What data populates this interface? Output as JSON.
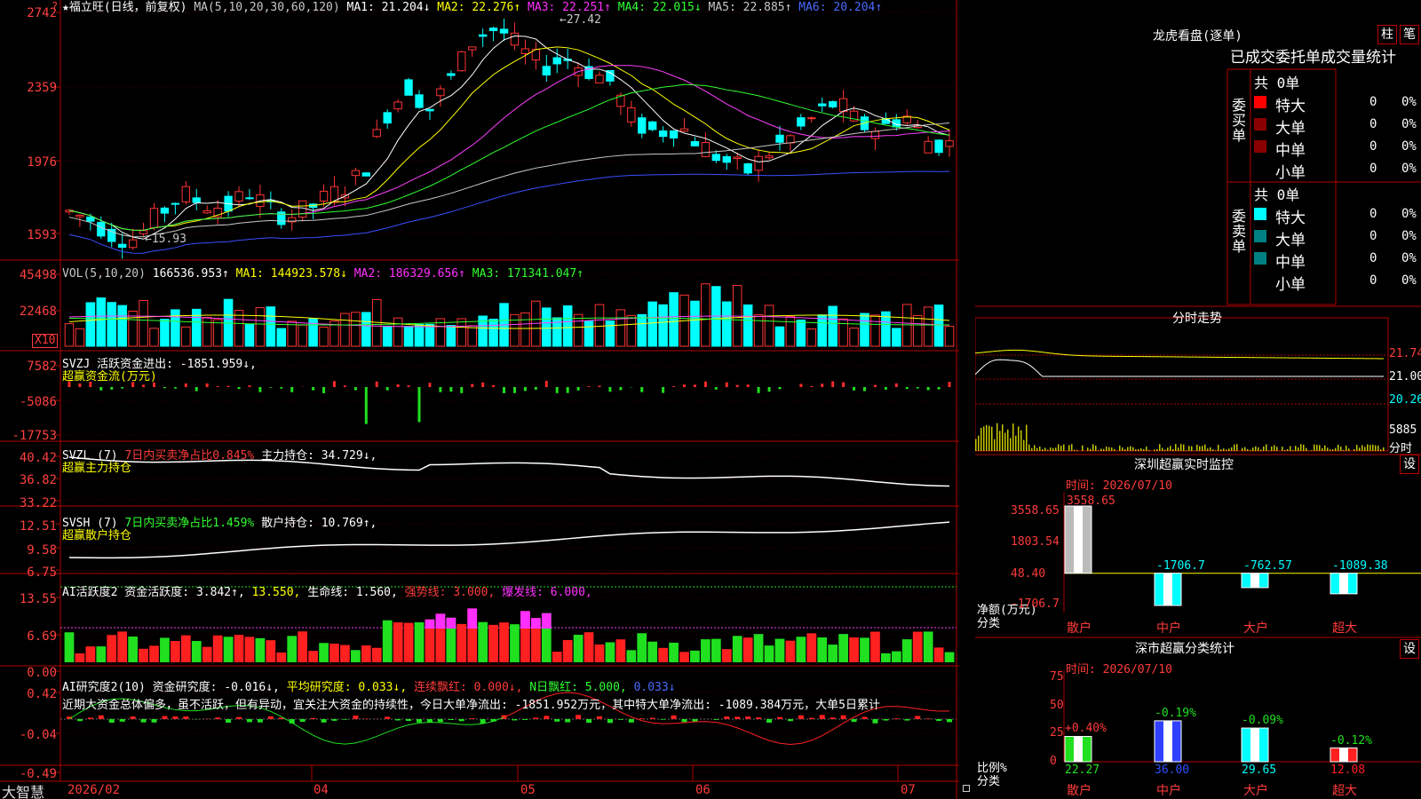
{
  "colors": {
    "up": "#ff3333",
    "down": "#00ffff",
    "bg": "#000000",
    "grid": "#b00000",
    "ma1": "#ffffff",
    "ma2": "#ffff00",
    "ma3": "#ff40ff",
    "ma4": "#30ff30",
    "ma5": "#c8c8c8",
    "ma6": "#3a50ff"
  },
  "main": {
    "title": "★福立旺(日线，前复权)",
    "ma_params": "MA(5,10,20,30,60,120)",
    "ma1": "MA1: 21.204↓",
    "ma2": "MA2: 22.276↑",
    "ma3": "MA3: 22.251↑",
    "ma4": "MA4: 22.015↓",
    "ma5": "MA5: 22.885↑",
    "ma6": "MA6: 20.204↑",
    "ticks": [
      "2742",
      "2359",
      "1976",
      "1593"
    ],
    "high_mark": "27.42",
    "low_mark": "15.93"
  },
  "vol": {
    "label": "VOL(5,10,20)",
    "value": "166536.953↑",
    "ma1": "MA1: 144923.578↓",
    "ma2": "MA2: 186329.656↑",
    "ma3": "MA3: 171341.047↑",
    "ticks": [
      "45498",
      "22468"
    ],
    "unit": "X10"
  },
  "svzj": {
    "label": "SVZJ  活跃资金进出: -1851.959↓,",
    "sub": "超赢资金流(万元)",
    "ticks": [
      "7582",
      "-5086",
      "-17753"
    ]
  },
  "svzl": {
    "label": "SVZL (7)",
    "pct": "7日内买卖净占比0.845%",
    "hold": "主力持仓: 34.729↓,",
    "sub": "超赢主力持仓",
    "ticks": [
      "40.42",
      "36.82",
      "33.22"
    ]
  },
  "svsh": {
    "label": "SVSH (7)",
    "pct": "7日内买卖净占比1.459%",
    "hold": "散户持仓: 10.769↑,",
    "sub": "超赢散户持仓",
    "ticks": [
      "12.51",
      "9.58",
      "6.75"
    ]
  },
  "ai1": {
    "label": "AI活跃度2 资金活跃度: 3.842↑,",
    "v2": "13.550,",
    "life": "生命线: 1.560,",
    "strong": "强势线: 3.000,",
    "burst": "爆发线: 6.000,",
    "ticks": [
      "13.55",
      "6.69",
      "0.00"
    ]
  },
  "ai2": {
    "label": "AI研究度2(10) 资金研究度: -0.016↓,",
    "avg": "平均研究度: 0.033↓,",
    "red": "连续飘红: 0.000↓,",
    "nday": "N日飘红: 5.000,",
    "last": "0.033↓",
    "desc": "近期大资金总体偏多，虽不活跃，但有异动，宜关注大资金的持续性，今日大单净流出: -1851.952万元，其中特大单净流出: -1089.384万元，大单5日累计",
    "ticks": [
      "0.42",
      "-0.04",
      "-0.49"
    ]
  },
  "xaxis": {
    "labels": [
      "2026/02",
      "04",
      "05",
      "06",
      "07"
    ],
    "brand": "大智慧"
  },
  "right": {
    "lhb_title": "龙虎看盘(逐单)",
    "btn1": "柱",
    "btn2": "笔",
    "stat_header": "已成交委托单成交量统计",
    "buy_label": "委买单",
    "sell_label": "委卖单",
    "total": "共 0单",
    "rows": [
      "特大",
      "大单",
      "中单",
      "小单"
    ],
    "zero": "0",
    "pct": "0%",
    "buy_colors": [
      "#ff0000",
      "#8a0000",
      "#8a0000",
      "#000000"
    ],
    "sell_colors": [
      "#00ffff",
      "#008080",
      "#008080",
      "#000000"
    ],
    "fs_title": "分时走势",
    "fs_ticks": [
      "21.74",
      "21.00",
      "20.26"
    ],
    "fs_vol": "5885",
    "fs_vol_unit": "分时",
    "mon_title": "深圳超赢实时监控",
    "mon_btn": "设",
    "mon_time": "时间: 2026/07/10",
    "mon_ticks": [
      "3558.65",
      "1803.54",
      "48.40",
      "-1706.7"
    ],
    "mon_unit": "净额(万元)",
    "mon_unit2": "分类",
    "mon_cats": [
      "散户",
      "中户",
      "大户",
      "超大"
    ],
    "mon_values": [
      3558.65,
      -1706.7,
      -762.57,
      -1089.38
    ],
    "mon_value_labels": [
      "3558.65",
      "-1706.7",
      "-762.57",
      "-1089.38"
    ],
    "cls_title": "深市超赢分类统计",
    "cls_btn": "设",
    "cls_time": "时间: 2026/07/10",
    "cls_ticks": [
      "75",
      "50",
      "25",
      "0"
    ],
    "cls_unit": "比例%",
    "cls_unit2": "分类",
    "cls_values": [
      22.27,
      36.0,
      29.65,
      12.08
    ],
    "cls_value_labels": [
      "22.27",
      "36.00",
      "29.65",
      "12.08"
    ],
    "cls_change_labels": [
      "+0.40%",
      "-0.19%",
      "-0.09%",
      "-0.12%"
    ]
  }
}
